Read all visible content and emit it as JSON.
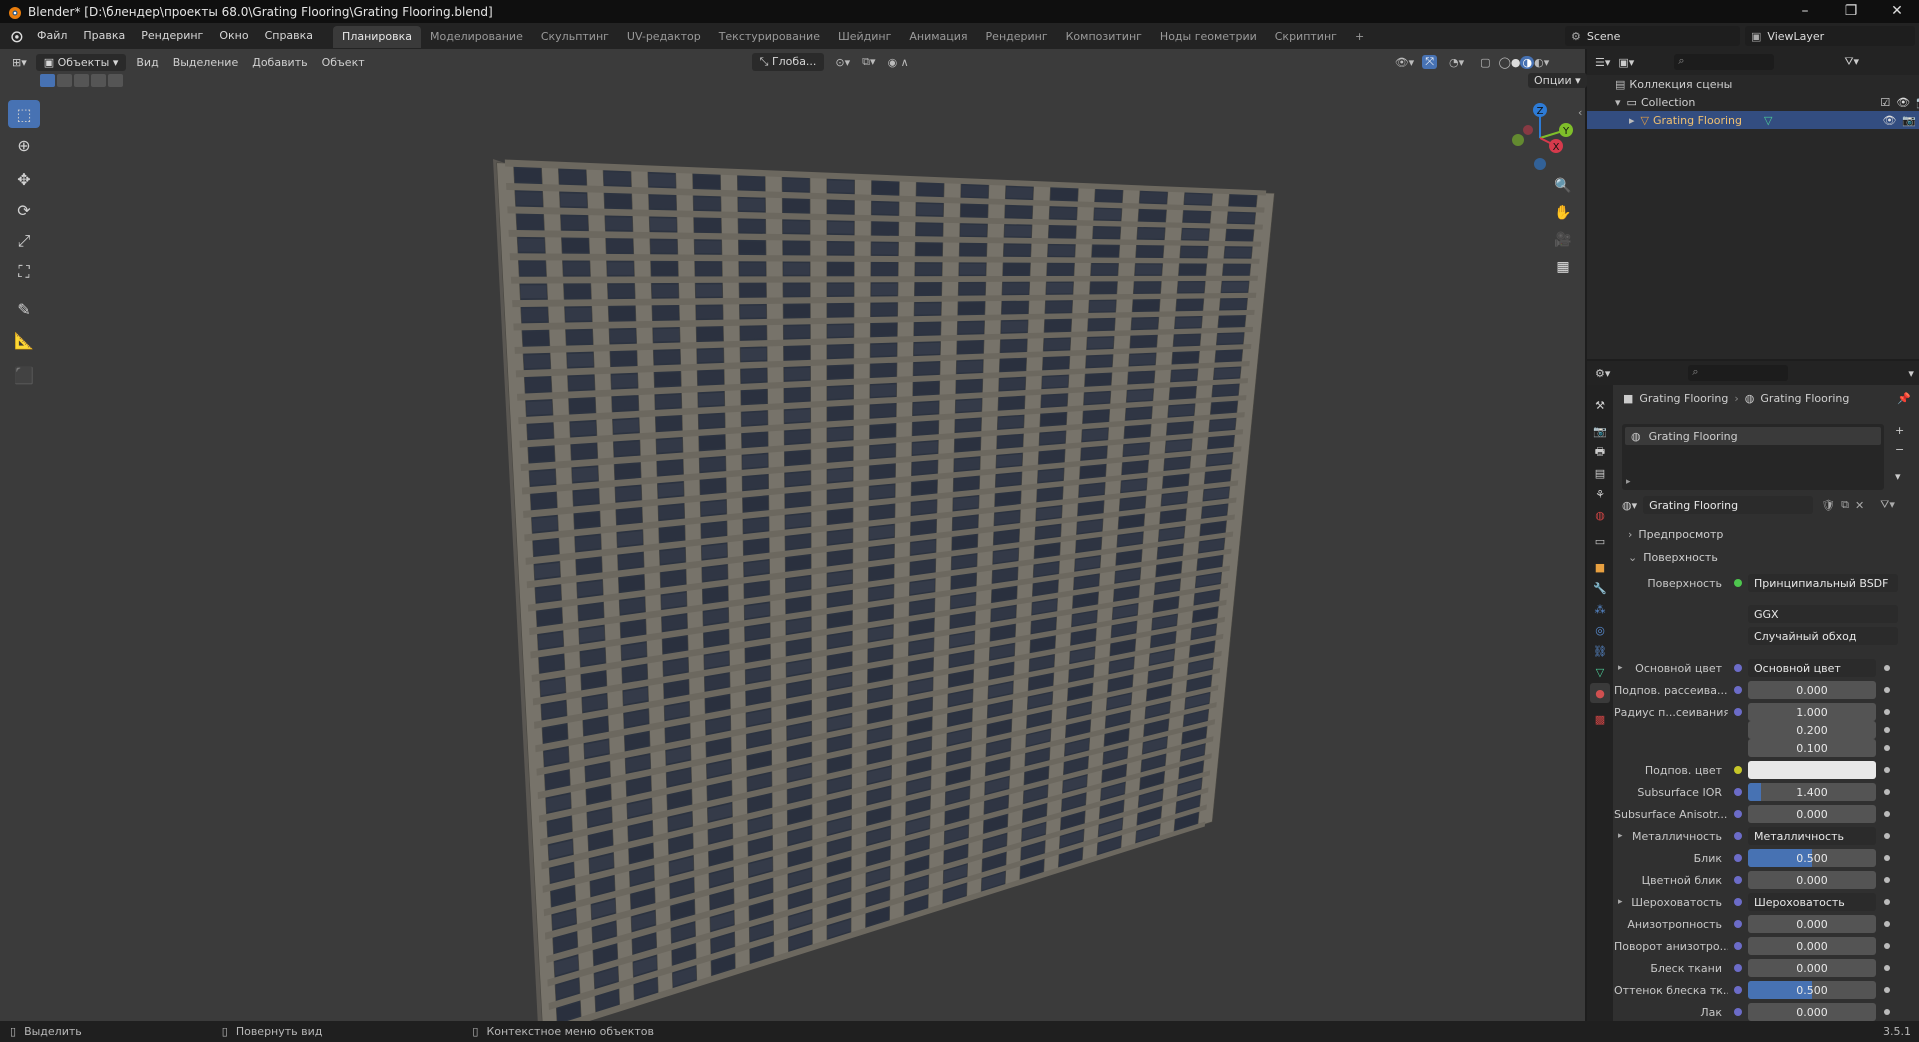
{
  "titlebar": {
    "title": "Blender* [D:\\блендер\\проекты 68.0\\Grating Flooring\\Grating Flooring.blend]"
  },
  "menu": [
    "Файл",
    "Правка",
    "Рендеринг",
    "Окно",
    "Справка"
  ],
  "workspaces": [
    {
      "label": "Планировка",
      "active": true
    },
    {
      "label": "Моделирование"
    },
    {
      "label": "Скульптинг"
    },
    {
      "label": "UV-редактор"
    },
    {
      "label": "Текстурирование"
    },
    {
      "label": "Шейдинг"
    },
    {
      "label": "Анимация"
    },
    {
      "label": "Рендеринг"
    },
    {
      "label": "Композитинг"
    },
    {
      "label": "Ноды геометрии"
    },
    {
      "label": "Скриптинг"
    }
  ],
  "add_workspace": "+",
  "scene": "Scene",
  "view_layer": "ViewLayer",
  "viewport": {
    "mode": "Объекты",
    "menus": [
      "Вид",
      "Выделение",
      "Добавить",
      "Объект"
    ],
    "transform_orientation": "Глоба...",
    "options": "Опции",
    "gizmo_axes": {
      "x": "X",
      "y": "Y",
      "z": "Z"
    },
    "accent": "#4772b3"
  },
  "outliner": {
    "root": "Коллекция сцены",
    "collection": "Collection",
    "object": "Grating Flooring"
  },
  "properties": {
    "breadcrumb": [
      "Grating Flooring",
      "Grating Flooring"
    ],
    "slot": "Grating Flooring",
    "material_name": "Grating Flooring",
    "panels": {
      "preview": "Предпросмотр",
      "surface": "Поверхность"
    },
    "surface_label": "Поверхность",
    "surface_value": "Принципиальный BSDF",
    "distribution": "GGX",
    "subsurface_method": "Случайный обход",
    "rows": [
      {
        "label": "Основной цвет",
        "value": "Основной цвет",
        "kind": "link",
        "expand": true
      },
      {
        "label": "Подпов. рассеива...",
        "value": "0.000",
        "kind": "num"
      },
      {
        "label": "Радиус п...сеивания",
        "value": "1.000",
        "kind": "num"
      },
      {
        "label": "",
        "value": "0.200",
        "kind": "num"
      },
      {
        "label": "",
        "value": "0.100",
        "kind": "num"
      },
      {
        "label": "Подпов. цвет",
        "value": "",
        "kind": "color"
      },
      {
        "label": "Subsurface IOR",
        "value": "1.400",
        "kind": "slider",
        "fill": 0.1
      },
      {
        "label": "Subsurface Anisotr...",
        "value": "0.000",
        "kind": "num"
      },
      {
        "label": "Металличность",
        "value": "Металличность",
        "kind": "link",
        "expand": true
      },
      {
        "label": "Блик",
        "value": "0.500",
        "kind": "slider",
        "fill": 0.5
      },
      {
        "label": "Цветной блик",
        "value": "0.000",
        "kind": "num"
      },
      {
        "label": "Шероховатость",
        "value": "Шероховатость",
        "kind": "link",
        "expand": true
      },
      {
        "label": "Анизотропность",
        "value": "0.000",
        "kind": "num"
      },
      {
        "label": "Поворот анизотро...",
        "value": "0.000",
        "kind": "num"
      },
      {
        "label": "Блеск ткани",
        "value": "0.000",
        "kind": "num"
      },
      {
        "label": "Оттенок блеска тк...",
        "value": "0.500",
        "kind": "slider",
        "fill": 0.5
      },
      {
        "label": "Лак",
        "value": "0.000",
        "kind": "num"
      }
    ]
  },
  "statusbar": {
    "select": "Выделить",
    "rotate": "Повернуть вид",
    "context": "Контекстное меню объектов",
    "version": "3.5.1"
  }
}
